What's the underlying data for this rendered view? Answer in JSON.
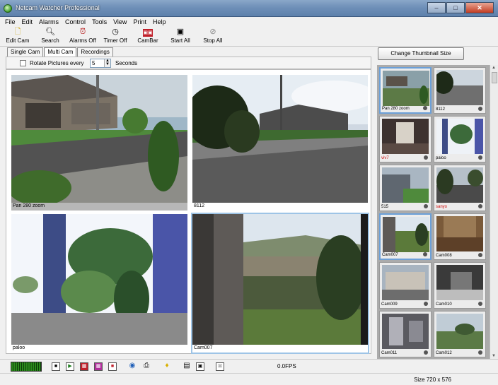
{
  "window": {
    "title": "Netcam Watcher Professional",
    "controls": [
      "–",
      "□",
      "✕"
    ]
  },
  "menu": [
    "File",
    "Edit",
    "Alarms",
    "Control",
    "Tools",
    "View",
    "Print",
    "Help"
  ],
  "toolbar": [
    {
      "label": "Edit Cam",
      "icon": "edit-icon"
    },
    {
      "label": "Search",
      "icon": "search-icon"
    },
    {
      "label": "Alarms Off",
      "icon": "alarm-icon"
    },
    {
      "label": "Timer Off",
      "icon": "timer-icon"
    },
    {
      "label": "CamBar",
      "icon": "cambar-icon"
    },
    {
      "label": "Start All",
      "icon": "camera-icon"
    },
    {
      "label": "Stop All",
      "icon": "stop-icon"
    }
  ],
  "tabs": [
    "Single Cam",
    "Multi Cam",
    "Recordings"
  ],
  "rotate": {
    "label": "Rotate Pictures every",
    "value": "5",
    "unit": "Seconds"
  },
  "multicam": [
    "Pan 280 zoom",
    "8112",
    "paloo",
    "Cam007"
  ],
  "thumbnail_button": "Change Thumbnail Size",
  "thumbnails": [
    {
      "label": "Pan 280 zoom",
      "alert": false
    },
    {
      "label": "8112",
      "alert": false
    },
    {
      "label": "viv7",
      "alert": true
    },
    {
      "label": "paloo",
      "alert": false
    },
    {
      "label": "515",
      "alert": false
    },
    {
      "label": "sanyo",
      "alert": true
    },
    {
      "label": "Cam007",
      "alert": false
    },
    {
      "label": "Cam008",
      "alert": false
    },
    {
      "label": "Cam009",
      "alert": false
    },
    {
      "label": "Cam010",
      "alert": false
    },
    {
      "label": "Cam011",
      "alert": false
    },
    {
      "label": "Cam012",
      "alert": false
    }
  ],
  "fps": "0.0FPS",
  "status": {
    "size": "Size 720 x 576"
  },
  "colors": {
    "title_bar": "#6f90b8",
    "selection": "#9ec4e6",
    "alert_text": "#d01010"
  }
}
